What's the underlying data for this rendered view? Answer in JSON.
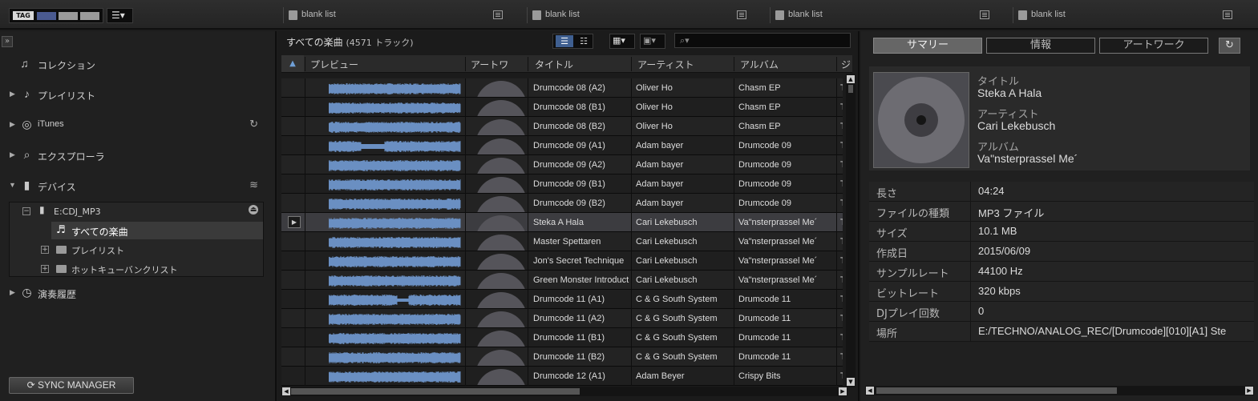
{
  "topbar": {
    "tag_label": "TAG",
    "tag_colors": [
      "#4a5a90",
      "#9a9a9a",
      "#9a9a9a"
    ],
    "list_icon": "list-icon",
    "blank_lists": [
      "blank list",
      "blank list",
      "blank list",
      "blank list"
    ]
  },
  "sidebar": {
    "collection": "コレクション",
    "playlist": "プレイリスト",
    "itunes": "iTunes",
    "explorer": "エクスプローラ",
    "device": "デバイス",
    "device_name": "E:CDJ_MP3",
    "all_tracks": "すべての楽曲",
    "device_playlist": "プレイリスト",
    "hot_cue": "ホットキューバンクリスト",
    "history": "演奏履歴",
    "sync": "SYNC MANAGER"
  },
  "browser": {
    "title": "すべての楽曲",
    "count": "(4571 トラック)",
    "search_placeholder": "",
    "columns": [
      "プレビュー",
      "アートワ",
      "タイトル",
      "アーティスト",
      "アルバム",
      "ジ"
    ],
    "selected_index": 7,
    "rows": [
      {
        "title": "Drumcode 08 (A2)",
        "artist": "Oliver Ho",
        "album": "Chasm EP",
        "extra": "T"
      },
      {
        "title": "Drumcode 08 (B1)",
        "artist": "Oliver Ho",
        "album": "Chasm EP",
        "extra": "T"
      },
      {
        "title": "Drumcode 08 (B2)",
        "artist": "Oliver Ho",
        "album": "Chasm EP",
        "extra": "T"
      },
      {
        "title": "Drumcode 09 (A1)",
        "artist": "Adam bayer",
        "album": "Drumcode 09",
        "extra": "T"
      },
      {
        "title": "Drumcode 09 (A2)",
        "artist": "Adam bayer",
        "album": "Drumcode 09",
        "extra": "T"
      },
      {
        "title": "Drumcode 09 (B1)",
        "artist": "Adam bayer",
        "album": "Drumcode 09",
        "extra": "T"
      },
      {
        "title": "Drumcode 09 (B2)",
        "artist": "Adam bayer",
        "album": "Drumcode 09",
        "extra": "T"
      },
      {
        "title": "Steka A Hala",
        "artist": "Cari Lekebusch",
        "album": "Va\"nsterprassel Me´",
        "extra": "T"
      },
      {
        "title": "Master Spettaren",
        "artist": "Cari Lekebusch",
        "album": "Va\"nsterprassel Me´",
        "extra": "T"
      },
      {
        "title": "Jon's Secret Technique",
        "artist": "Cari Lekebusch",
        "album": "Va\"nsterprassel Me´",
        "extra": "T"
      },
      {
        "title": "Green Monster Introducti",
        "artist": "Cari Lekebusch",
        "album": "Va\"nsterprassel Me´",
        "extra": "T"
      },
      {
        "title": "Drumcode 11 (A1)",
        "artist": "C & G South System",
        "album": "Drumcode 11",
        "extra": "T"
      },
      {
        "title": "Drumcode 11 (A2)",
        "artist": "C & G South System",
        "album": "Drumcode 11",
        "extra": "T"
      },
      {
        "title": "Drumcode 11 (B1)",
        "artist": "C & G South System",
        "album": "Drumcode 11",
        "extra": "T"
      },
      {
        "title": "Drumcode 11 (B2)",
        "artist": "C & G South System",
        "album": "Drumcode 11",
        "extra": "T"
      },
      {
        "title": "Drumcode 12 (A1)",
        "artist": "Adam Beyer",
        "album": "Crispy Bits",
        "extra": "T"
      }
    ]
  },
  "info": {
    "tabs": [
      "サマリー",
      "情報",
      "アートワーク"
    ],
    "title_label": "タイトル",
    "title": "Steka A Hala",
    "artist_label": "アーティスト",
    "artist": "Cari Lekebusch",
    "album_label": "アルバム",
    "album": "Va\"nsterprassel Me´",
    "details": [
      {
        "label": "長さ",
        "value": "04:24"
      },
      {
        "label": "ファイルの種類",
        "value": "MP3 ファイル"
      },
      {
        "label": "サイズ",
        "value": "10.1 MB"
      },
      {
        "label": "作成日",
        "value": "2015/06/09"
      },
      {
        "label": "サンプルレート",
        "value": "44100 Hz"
      },
      {
        "label": "ビットレート",
        "value": "320 kbps"
      },
      {
        "label": "DJプレイ回数",
        "value": "0"
      },
      {
        "label": "場所",
        "value": "E:/TECHNO/ANALOG_REC/[Drumcode][010][A1] Ste"
      }
    ]
  },
  "colors": {
    "accent": "#6f9fd6",
    "waveform": "#6a8fc2",
    "selected_row": "#3c3c40"
  }
}
